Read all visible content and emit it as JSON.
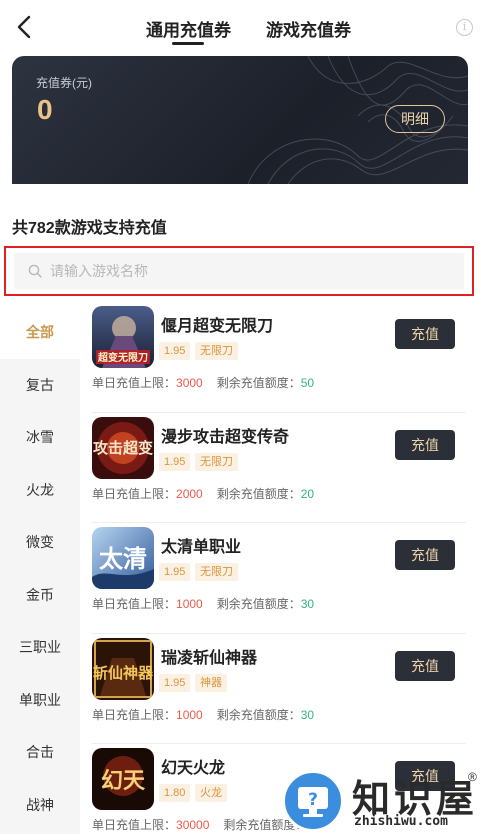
{
  "header": {
    "tabs": [
      {
        "label": "通用充值券",
        "active": true
      },
      {
        "label": "游戏充值券",
        "active": false
      }
    ],
    "back_icon": "chevron-left-icon",
    "info_icon": "info-icon",
    "info_glyph": "i"
  },
  "balance_card": {
    "label": "充值券(元)",
    "value": "0",
    "detail_button": "明细"
  },
  "games_count_title": "共782款游戏支持充值",
  "search": {
    "placeholder": "请输入游戏名称",
    "value": ""
  },
  "sidebar": {
    "items": [
      {
        "label": "全部",
        "active": true
      },
      {
        "label": "复古",
        "active": false
      },
      {
        "label": "冰雪",
        "active": false
      },
      {
        "label": "火龙",
        "active": false
      },
      {
        "label": "微变",
        "active": false
      },
      {
        "label": "金币",
        "active": false
      },
      {
        "label": "三职业",
        "active": false
      },
      {
        "label": "单职业",
        "active": false
      },
      {
        "label": "合击",
        "active": false
      },
      {
        "label": "战神",
        "active": false
      }
    ]
  },
  "list_labels": {
    "daily_limit": "单日充值上限：",
    "remaining": "剩余充值额度：",
    "charge_button": "充值"
  },
  "games": [
    {
      "name": "偃月超变无限刀",
      "discount": "1.95",
      "keyword": "无限刀",
      "daily_limit": "3000",
      "remaining": "50",
      "icon_text": "超变无限刀"
    },
    {
      "name": "漫步攻击超变传奇",
      "discount": "1.95",
      "keyword": "无限刀",
      "daily_limit": "2000",
      "remaining": "20",
      "icon_text": "攻击超变"
    },
    {
      "name": "太清单职业",
      "discount": "1.95",
      "keyword": "无限刀",
      "daily_limit": "1000",
      "remaining": "30",
      "icon_text": "太清"
    },
    {
      "name": "瑞凌斩仙神器",
      "discount": "1.95",
      "keyword": "神器",
      "daily_limit": "1000",
      "remaining": "30",
      "icon_text": "斩仙神器"
    },
    {
      "name": "幻天火龙",
      "discount": "1.80",
      "keyword": "火龙",
      "daily_limit": "30000",
      "remaining": "",
      "icon_text": "幻天"
    }
  ],
  "watermark": {
    "logo_text": "知识屋",
    "reg_mark": "®",
    "url": "zhishiwu.com"
  },
  "colors": {
    "accent_gold": "#c99a4e",
    "dark_button": "#2b2f38",
    "limit_red": "#ef5b4b",
    "remaining_green": "#36b37e",
    "highlight_border": "#e02020"
  }
}
